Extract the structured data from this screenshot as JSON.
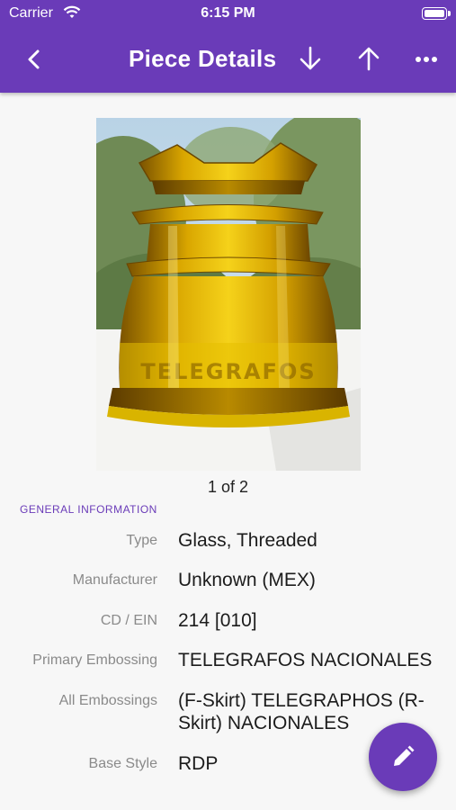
{
  "status_bar": {
    "carrier": "Carrier",
    "time": "6:15 PM"
  },
  "header": {
    "title": "Piece Details"
  },
  "image": {
    "counter": "1 of 2",
    "embossing_on_glass": "TELEGRAFOS"
  },
  "section_title": "GENERAL INFORMATION",
  "details": [
    {
      "label": "Type",
      "value": "Glass, Threaded"
    },
    {
      "label": "Manufacturer",
      "value": "Unknown (MEX)"
    },
    {
      "label": "CD / EIN",
      "value": "214 [010]"
    },
    {
      "label": "Primary Embossing",
      "value": "TELEGRAFOS NACIONALES"
    },
    {
      "label": "All Embossings",
      "value": "(F-Skirt) TELEGRAPHOS (R-Skirt) NACIONALES"
    },
    {
      "label": "Base Style",
      "value": "RDP"
    }
  ],
  "colors": {
    "accent": "#6a3bb8",
    "glass": "#e0b010"
  },
  "icons": [
    "back-chevron-icon",
    "arrow-down-icon",
    "arrow-up-icon",
    "more-icon",
    "pencil-icon",
    "wifi-icon",
    "battery-icon"
  ]
}
